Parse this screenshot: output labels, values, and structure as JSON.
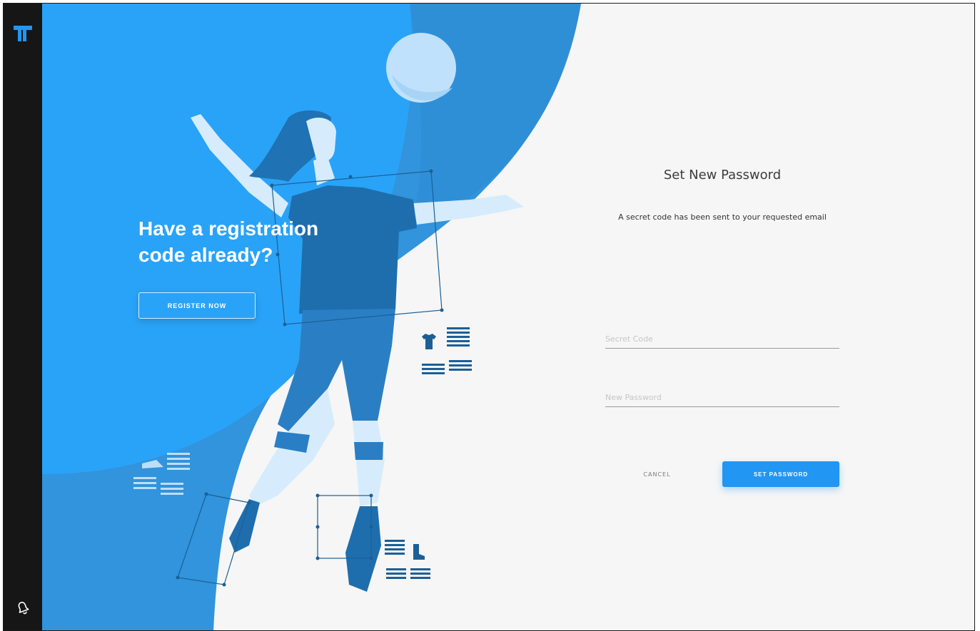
{
  "hero": {
    "headline_line1": "Have a registration",
    "headline_line2": "code already?",
    "register_label": "REGISTER NOW"
  },
  "form": {
    "title": "Set New Password",
    "subtitle": "A secret code has been sent to your requested email",
    "secret_code_placeholder": "Secret Code",
    "secret_code_value": "",
    "new_password_placeholder": "New Password",
    "new_password_value": "",
    "cancel_label": "CANCEL",
    "submit_label": "SET PASSWORD"
  },
  "icons": {
    "logo": "brand-logo-icon",
    "notifications": "bell-icon"
  },
  "colors": {
    "primary": "#2196f3",
    "sidebar": "#161616",
    "hero_light": "#29a3f8",
    "hero_mid": "#3194dc",
    "hero_dark": "#1c6fae",
    "form_bg": "#f6f6f6"
  }
}
